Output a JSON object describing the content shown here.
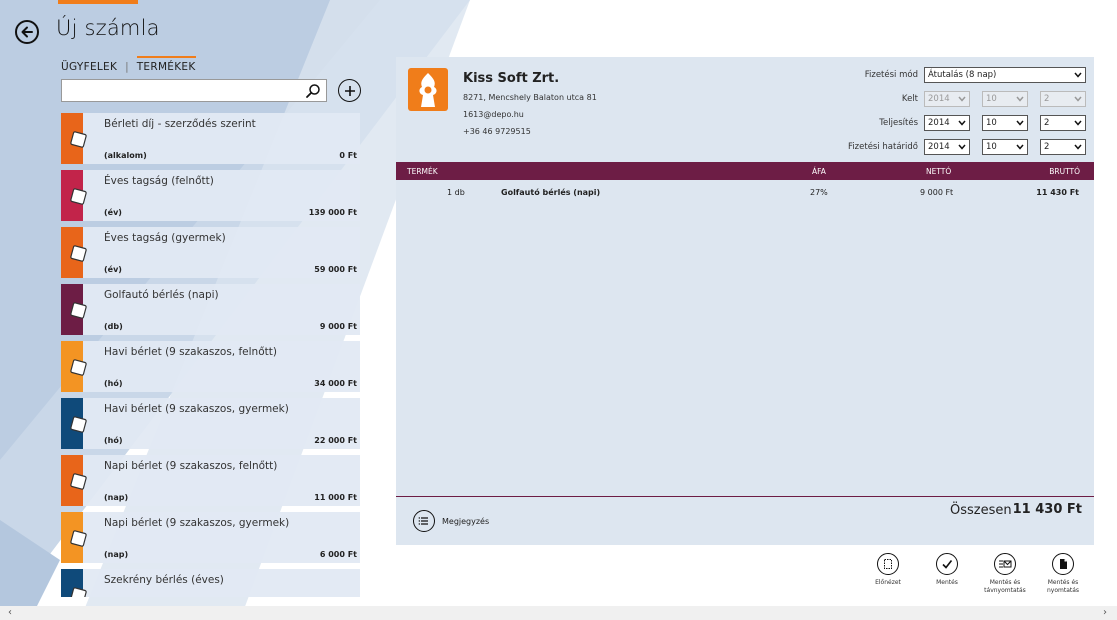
{
  "header": {
    "title": "Új számla"
  },
  "tabs": [
    {
      "label": "ÜGYFELEK"
    },
    {
      "label": "TERMÉKEK",
      "active": true
    }
  ],
  "tab_separator": "|",
  "search": {
    "value": "",
    "placeholder": ""
  },
  "products": [
    {
      "name": "Bérleti díj - szerződés szerint",
      "unit": "(alkalom)",
      "price": "0 Ft",
      "color": "#e8651a"
    },
    {
      "name": "Éves tagság (felnőtt)",
      "unit": "(év)",
      "price": "139 000 Ft",
      "color": "#c2244a"
    },
    {
      "name": "Éves tagság (gyermek)",
      "unit": "(év)",
      "price": "59 000 Ft",
      "color": "#e8651a"
    },
    {
      "name": "Golfautó bérlés (napi)",
      "unit": "(db)",
      "price": "9 000 Ft",
      "color": "#6d1d45"
    },
    {
      "name": "Havi bérlet (9 szakaszos, felnőtt)",
      "unit": "(hó)",
      "price": "34 000 Ft",
      "color": "#f39423"
    },
    {
      "name": "Havi bérlet (9 szakaszos, gyermek)",
      "unit": "(hó)",
      "price": "22 000 Ft",
      "color": "#0f4a7a"
    },
    {
      "name": "Napi bérlet (9 szakaszos, felnőtt)",
      "unit": "(nap)",
      "price": "11 000 Ft",
      "color": "#e8651a"
    },
    {
      "name": "Napi bérlet (9 szakaszos, gyermek)",
      "unit": "(nap)",
      "price": "6 000 Ft",
      "color": "#f39423"
    },
    {
      "name": "Szekrény bérlés (éves)",
      "unit": "",
      "price": "",
      "color": "#0f4a7a"
    }
  ],
  "invoice": {
    "company": {
      "name": "Kiss Soft Zrt.",
      "address": "8271, Mencshely Balaton utca 81",
      "email": "1613@depo.hu",
      "phone": "+36 46 9729515"
    },
    "payment_method": {
      "label": "Fizetési mód",
      "value": "Átutalás (8 nap)"
    },
    "issued": {
      "label": "Kelt",
      "year": "2014",
      "month": "10",
      "day": "2"
    },
    "fulfillment": {
      "label": "Teljesítés",
      "year": "2014",
      "month": "10",
      "day": "2"
    },
    "due": {
      "label": "Fizetési határidő",
      "year": "2014",
      "month": "10",
      "day": "2"
    },
    "columns": {
      "product": "TERMÉK",
      "vat": "ÁFA",
      "net": "NETTÓ",
      "gross": "BRUTTÓ"
    },
    "rows": [
      {
        "qty": "1 db",
        "product": "Golfautó bérlés (napi)",
        "vat": "27%",
        "net": "9 000 Ft",
        "gross": "11 430 Ft"
      }
    ],
    "note_label": "Megjegyzés",
    "total_label": "Összesen",
    "total_value": "11 430 Ft"
  },
  "actions": [
    {
      "label": "Előnézet",
      "icon": "preview-icon"
    },
    {
      "label": "Mentés",
      "icon": "checkmark-icon"
    },
    {
      "label": "Mentés és távnyomtatás",
      "icon": "remote-print-icon"
    },
    {
      "label": "Mentés és nyomtatás",
      "icon": "print-icon"
    }
  ],
  "scroll": {
    "left": "‹",
    "right": "›"
  },
  "colors": {
    "accent": "#f07d1a",
    "header_bar": "#6d1d45",
    "panel": "#dde6f0"
  }
}
